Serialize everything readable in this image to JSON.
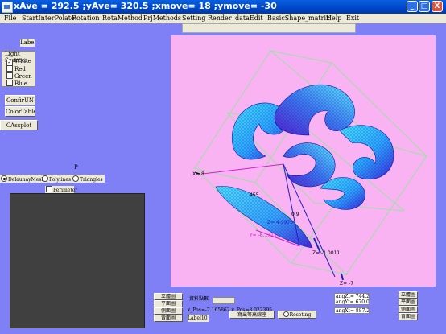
{
  "window": {
    "title": "xAve = 292.5 ;yAve= 320.5 ;xmove= 18 ;ymove= -30",
    "minimize": "_",
    "maximize": "□",
    "close": "X"
  },
  "menu": [
    "File",
    "StartInterPolate",
    "Rotation",
    "RotaMethod",
    "PrjMethods",
    "Setting",
    "Render",
    "dataEdit",
    "BasicShape_matrix",
    "Help",
    "Exit"
  ],
  "left_panel": {
    "label5": "Label5",
    "light_sources": {
      "title": "Light Sources",
      "items": [
        {
          "label": "White",
          "checked": true
        },
        {
          "label": "Red",
          "checked": false
        },
        {
          "label": "Green",
          "checked": false
        },
        {
          "label": "Blue",
          "checked": false
        }
      ]
    },
    "buttons": {
      "confirm": "ConfirUN",
      "color_table": "ColorTable",
      "cassplot": "CAssplot"
    },
    "p_label": "P",
    "radios": [
      {
        "label": "DelaunayMesh",
        "selected": true
      },
      {
        "label": "Polylines",
        "selected": false
      },
      {
        "label": "Triangles",
        "selected": false
      }
    ],
    "perimeter": {
      "label": "Perimeter",
      "checked": false
    }
  },
  "plot": {
    "labels": {
      "x_axis": "X= 8",
      "z1": "Z= 4.9975",
      "z_neg": "Z= -1.0011",
      "z_bottom": "Z= -7",
      "y_label": "Y= -6.1711",
      "mid_a": "455",
      "mid_b": "0.9"
    },
    "colors": {
      "background": "#f9b3f3",
      "frame": "#9be0a0",
      "surface_light": "#45e3ff",
      "surface_dark": "#3b25d8",
      "axis_blue": "#2020c0",
      "axis_magenta": "#d020d0"
    }
  },
  "bottom": {
    "left_buttons": [
      "立體圖",
      "平面圖",
      "側面圖",
      "背面圖"
    ],
    "label_data": "資料點數",
    "label_data_value": "",
    "pos_text": "x_Pos=-7.165862 y_Pos=8.022395",
    "label10": "Label10",
    "export_btn": "寫出等高線座",
    "reset_btn": "Reseting",
    "ang_boxes": [
      "angZt= 744.201",
      "angYt= 670.055",
      "angXt= 887.284"
    ],
    "right_buttons": [
      "立體圖",
      "平面圖",
      "側面圖",
      "背面圖"
    ]
  }
}
